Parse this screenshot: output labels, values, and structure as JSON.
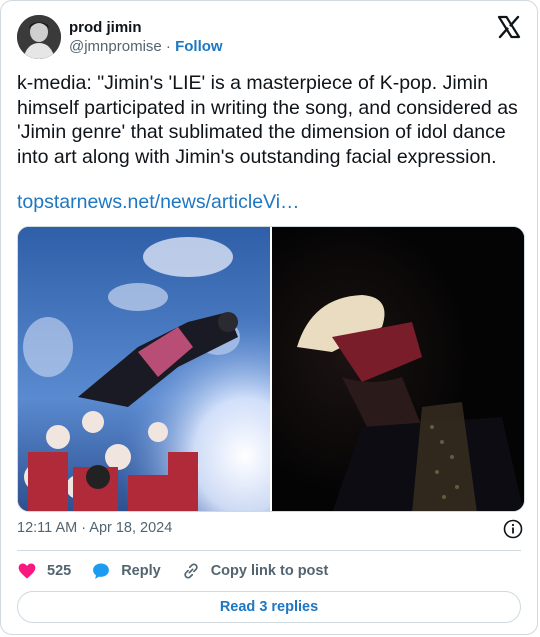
{
  "author": {
    "display_name": "prod jimin",
    "handle": "@jmnpromise",
    "separator": "·",
    "follow_label": "Follow"
  },
  "tweet": {
    "text": "k-media: \"Jimin's 'LIE' is a masterpiece of K-pop. Jimin himself participated in writing the song, and considered as 'Jimin genre' that sublimated the dimension of idol dance into art along with Jimin's outstanding facial expression.",
    "link_text": "topstarnews.net/news/articleVi…",
    "timestamp": "12:11 AM · Apr 18, 2024"
  },
  "actions": {
    "like_count": "525",
    "reply_label": "Reply",
    "copy_label": "Copy link to post"
  },
  "footer": {
    "read_replies_label": "Read 3 replies"
  },
  "icons": [
    "x-logo-icon",
    "info-icon",
    "heart-icon",
    "reply-bubble-icon",
    "link-icon"
  ],
  "colors": {
    "link": "#1d77c2",
    "heart": "#f91880",
    "muted": "#536471",
    "border": "#cfd9de"
  }
}
